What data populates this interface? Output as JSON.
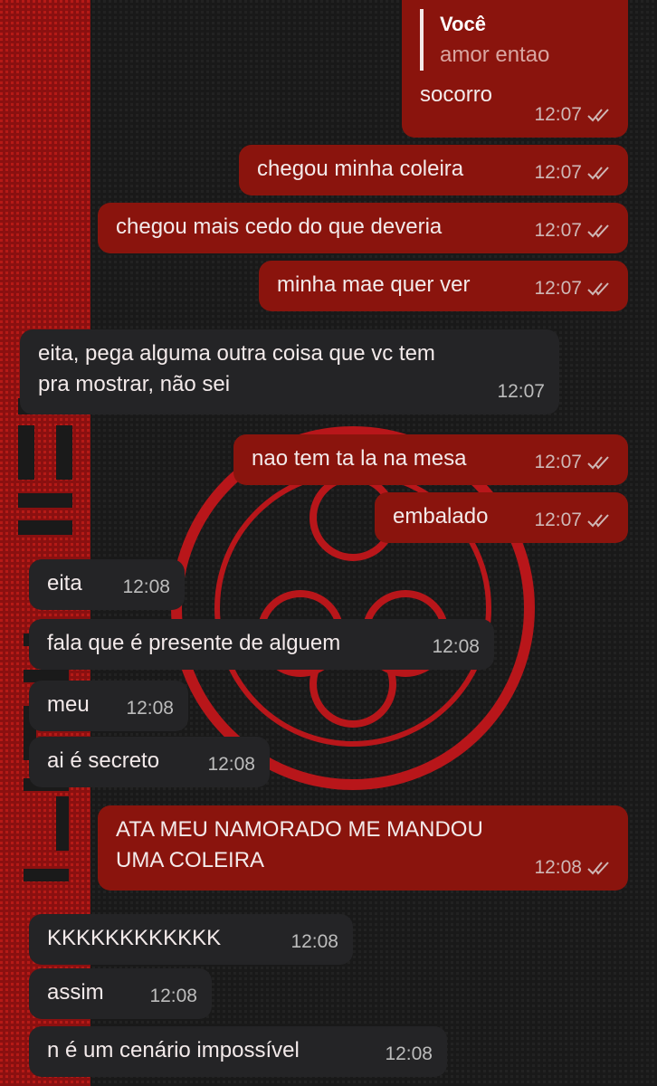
{
  "reply": {
    "name": "Você",
    "text": "amor entao"
  },
  "messages": [
    {
      "dir": "out",
      "text": "socorro",
      "time": "12:07"
    },
    {
      "dir": "out",
      "text": "chegou minha coleira",
      "time": "12:07"
    },
    {
      "dir": "out",
      "text": "chegou mais cedo do que deveria",
      "time": "12:07"
    },
    {
      "dir": "out",
      "text": "minha mae quer ver",
      "time": "12:07"
    },
    {
      "dir": "in",
      "text": "eita, pega alguma outra coisa que vc tem\npra mostrar, não sei",
      "time": "12:07"
    },
    {
      "dir": "out",
      "text": "nao tem ta la na mesa",
      "time": "12:07"
    },
    {
      "dir": "out",
      "text": "embalado",
      "time": "12:07"
    },
    {
      "dir": "in",
      "text": "eita",
      "time": "12:08"
    },
    {
      "dir": "in",
      "text": "fala que é presente de alguem",
      "time": "12:08"
    },
    {
      "dir": "in",
      "text": "meu",
      "time": "12:08"
    },
    {
      "dir": "in",
      "text": "ai é secreto",
      "time": "12:08"
    },
    {
      "dir": "out",
      "text": "ATA MEU NAMORADO ME MANDOU\nUMA COLEIRA",
      "time": "12:08"
    },
    {
      "dir": "in",
      "text": "KKKKKKKKKKKK",
      "time": "12:08"
    },
    {
      "dir": "in",
      "text": "assim",
      "time": "12:08"
    },
    {
      "dir": "in",
      "text": "n é um cenário impossível",
      "time": "12:08"
    }
  ],
  "colors": {
    "outgoing": "#8a140d",
    "incoming": "#242426",
    "accent": "#d01a12"
  }
}
